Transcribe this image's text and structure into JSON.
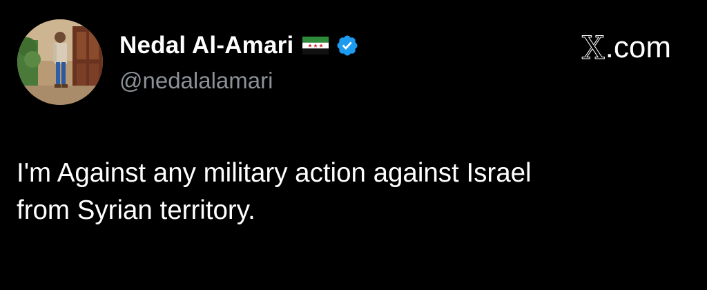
{
  "author": {
    "display_name": "Nedal Al-Amari",
    "handle": "@nedalalamari",
    "flag_icon": "syria-revolution-flag-icon",
    "verified_icon": "verified-badge-icon",
    "verified_color": "#1d9bf0"
  },
  "brand": {
    "x_letter": "X",
    "domain_suffix": ".com"
  },
  "tweet": {
    "line1": "I'm Against any military action against Israel",
    "line2": "from Syrian territory."
  },
  "colors": {
    "background": "#000000",
    "text": "#ffffff",
    "secondary_text": "#8b9197"
  }
}
